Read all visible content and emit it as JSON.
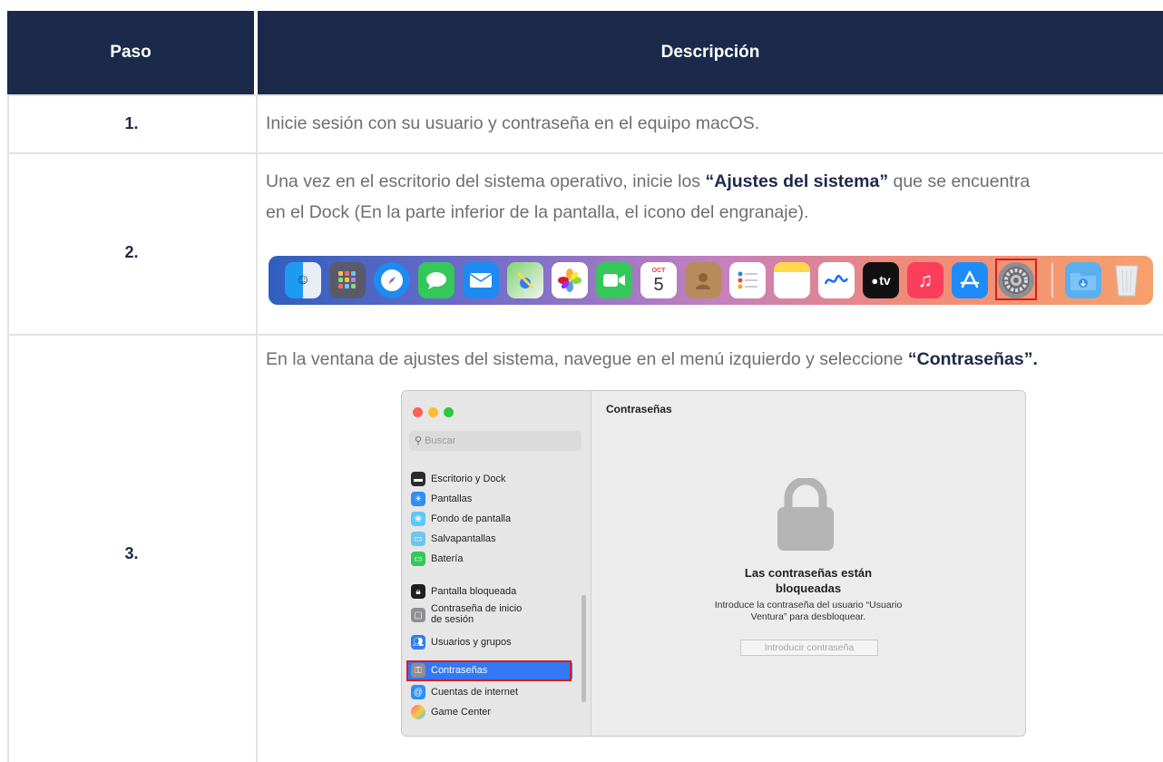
{
  "table": {
    "header_step": "Paso",
    "header_description": "Descripción"
  },
  "rows": [
    {
      "num": "1.",
      "text": "Inicie sesión con su usuario y contraseña en el equipo macOS."
    },
    {
      "num": "2.",
      "line1_pre": "Una vez en el escritorio del sistema operativo, inicie los ",
      "line1_bold": "“Ajustes del sistema”",
      "line1_post": " que se encuentra",
      "line2": "en el Dock (En la parte inferior de la pantalla, el icono del engranaje)."
    },
    {
      "num": "3.",
      "pre": "En la ventana de ajustes del sistema, navegue en el menú izquierdo y seleccione ",
      "bold": "“Contraseñas”."
    }
  ],
  "dock": {
    "calendar_month": "OCT",
    "calendar_day": "5",
    "tv_label": "tv",
    "items": [
      "finder-icon",
      "launchpad-icon",
      "safari-icon",
      "messages-icon",
      "mail-icon",
      "maps-icon",
      "photos-icon",
      "facetime-icon",
      "calendar-icon",
      "contacts-icon",
      "reminders-icon",
      "notes-icon",
      "freeform-icon",
      "apple-tv-icon",
      "music-icon",
      "app-store-icon",
      "system-settings-icon",
      "downloads-folder-icon",
      "trash-icon"
    ]
  },
  "window": {
    "search_placeholder": "Buscar",
    "title": "Contraseñas",
    "sidebar": [
      {
        "label": "Escritorio y Dock",
        "color": "#2b2b2b"
      },
      {
        "label": "Pantallas",
        "color": "#2f8ef5"
      },
      {
        "label": "Fondo de pantalla",
        "color": "#5ac8fa"
      },
      {
        "label": "Salvapantallas",
        "color": "#6ec6e8"
      },
      {
        "label": "Batería",
        "color": "#34c759"
      },
      {
        "label": "Pantalla bloqueada",
        "color": "#1f1f1f"
      },
      {
        "label_line1": "Contraseña de inicio",
        "label_line2": "de sesión",
        "color": "#8e8e93"
      },
      {
        "label": "Usuarios y grupos",
        "color": "#2f7cf6"
      },
      {
        "label": "Contraseñas",
        "color": "#8e8e93"
      },
      {
        "label": "Cuentas de internet",
        "color": "#2f8ef5"
      },
      {
        "label": "Game Center",
        "color": "#ff5e7a"
      }
    ],
    "locked_title_line1": "Las contraseñas están",
    "locked_title_line2": "bloqueadas",
    "locked_sub_line1": "Introduce la contraseña del usuario “Usuario",
    "locked_sub_line2": "Ventura” para desbloquear.",
    "password_placeholder": "Introducir contraseña"
  }
}
